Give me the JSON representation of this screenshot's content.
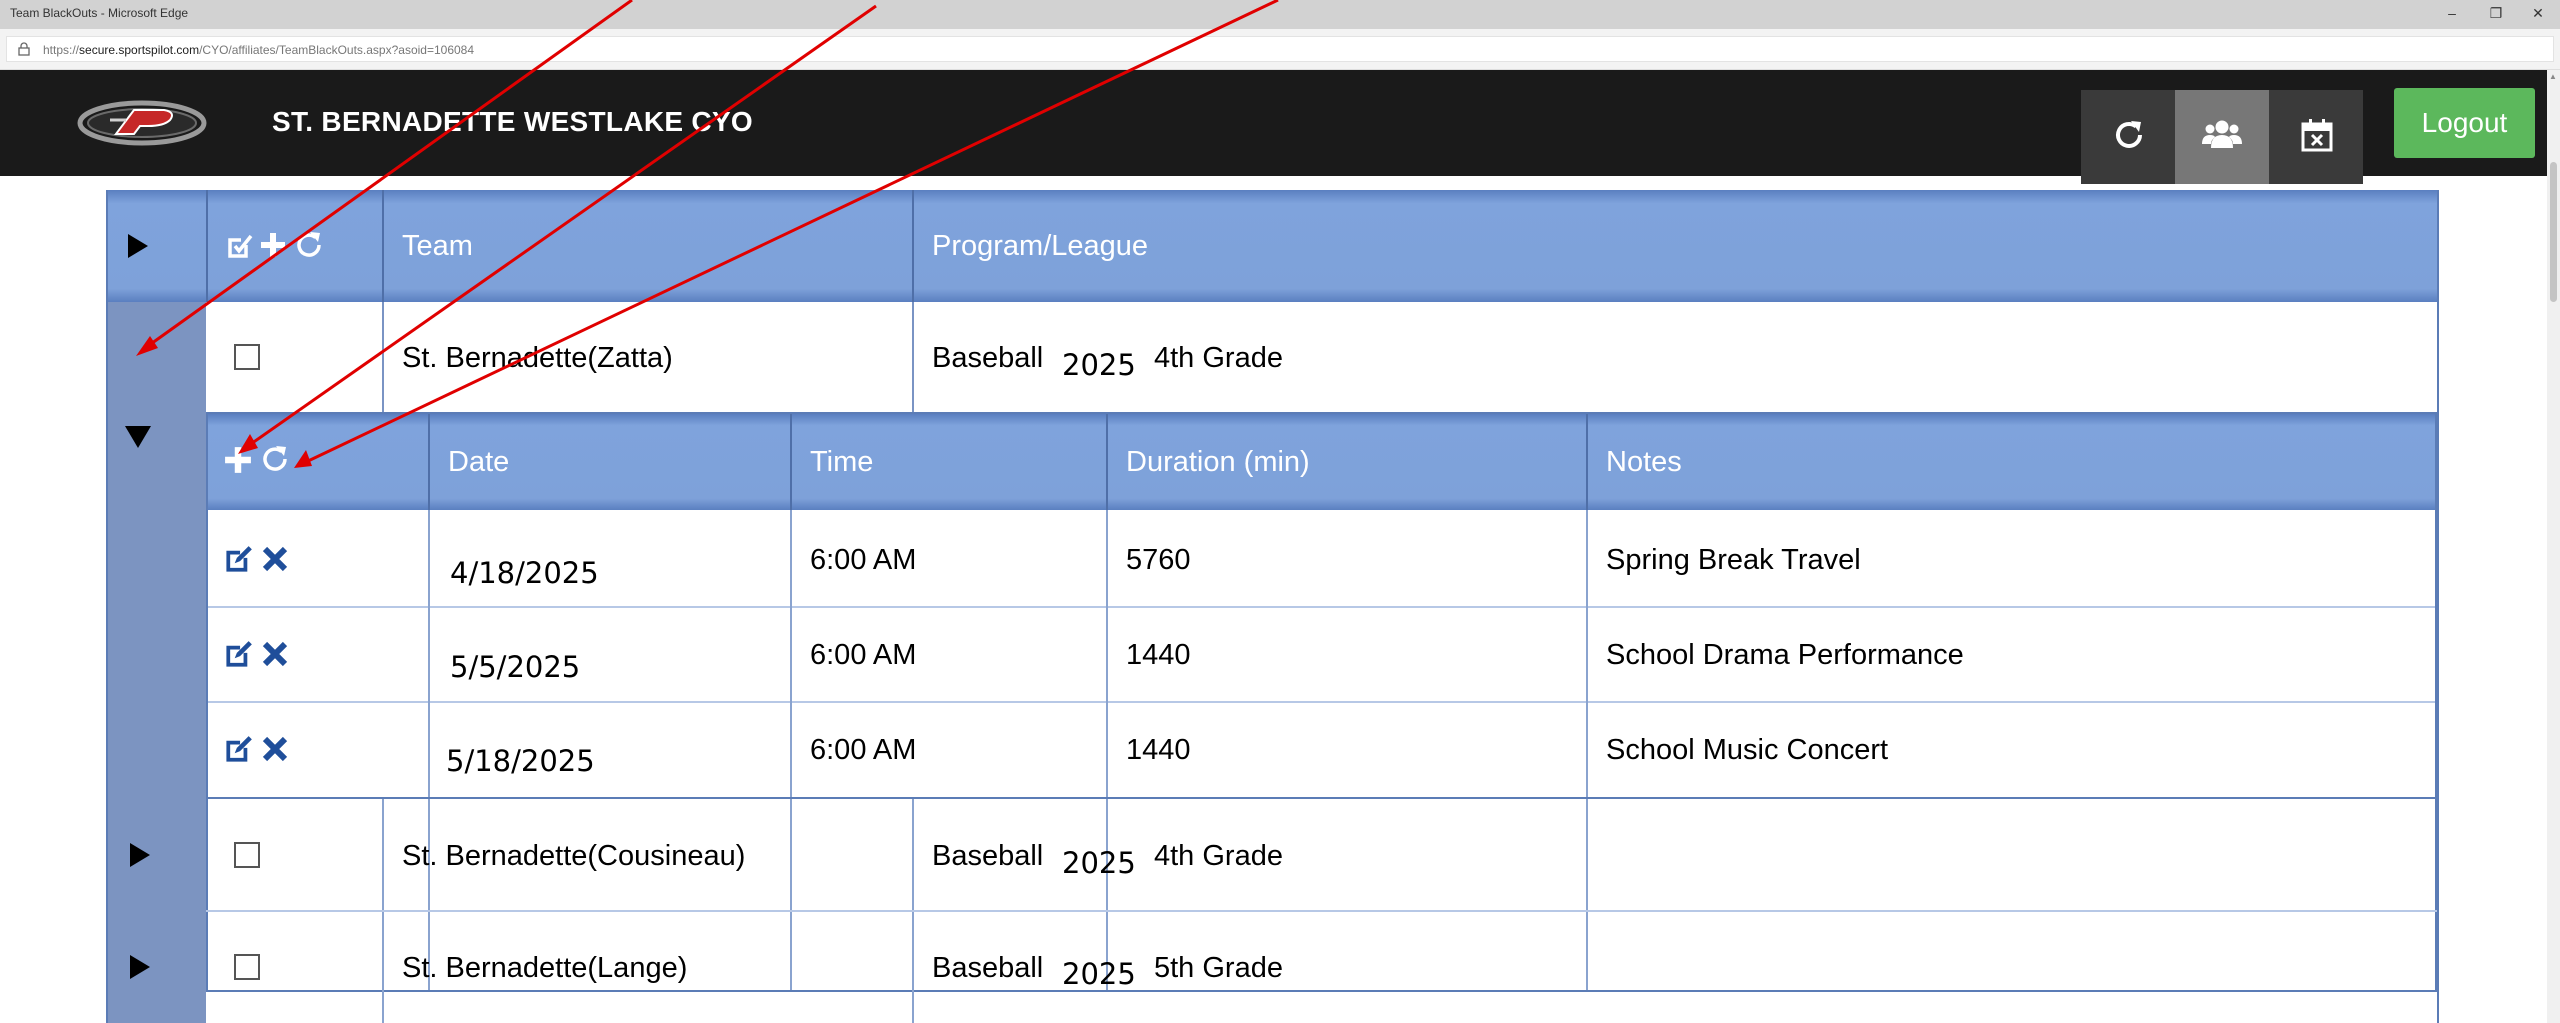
{
  "browser": {
    "window_title": "Team BlackOuts - Microsoft Edge",
    "url_prefix": "https://",
    "url_host": "secure.sportspilot.com",
    "url_path": "/CYO/affiliates/TeamBlackOuts.aspx?asoid=106084"
  },
  "header": {
    "org_name": "ST. BERNADETTE WESTLAKE CYO",
    "logout_label": "Logout",
    "buttons": [
      {
        "icon": "refresh-icon"
      },
      {
        "icon": "users-icon"
      },
      {
        "icon": "calendar-x-icon"
      }
    ]
  },
  "grid": {
    "columns": [
      "Team",
      "Program/League"
    ],
    "teams": [
      {
        "name": "St. Bernadette(Zatta)",
        "sport": "Baseball",
        "year": "2025",
        "grade": "4th Grade",
        "expanded": true
      },
      {
        "name": "St. Bernadette(Cousineau)",
        "sport": "Baseball",
        "year": "2025",
        "grade": "4th Grade",
        "expanded": false
      },
      {
        "name": "St. Bernadette(Lange)",
        "sport": "Baseball",
        "year": "2025",
        "grade": "5th Grade",
        "expanded": false
      }
    ]
  },
  "blackouts": {
    "columns": [
      "Date",
      "Time",
      "Duration (min)",
      "Notes"
    ],
    "rows": [
      {
        "date": "4/18/2025",
        "time": "6:00 AM",
        "duration": "5760",
        "notes": "Spring Break Travel"
      },
      {
        "date": "5/5/2025",
        "time": "6:00 AM",
        "duration": "1440",
        "notes": "School Drama Performance"
      },
      {
        "date": "5/18/2025",
        "time": "6:00 AM",
        "duration": "1440",
        "notes": "School Music Concert"
      }
    ]
  },
  "colors": {
    "header_bg": "#1a1a1a",
    "grid_header_blue": "#7ea1d9",
    "logout_green": "#5cb85c",
    "annotation_red": "#e00000",
    "action_icon_blue": "#1f4e9a"
  }
}
